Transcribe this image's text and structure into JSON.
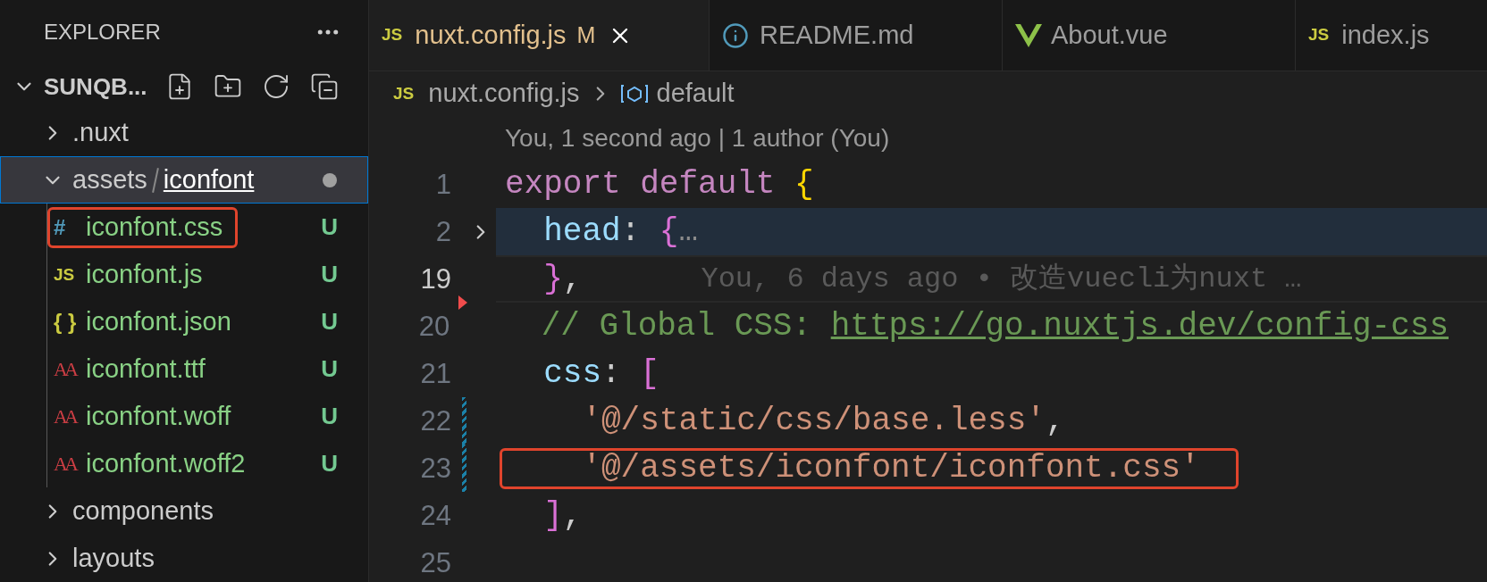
{
  "sidebar": {
    "title": "EXPLORER",
    "root": {
      "label": "SUNQB...",
      "expanded": true
    },
    "items": [
      {
        "label": ".nuxt",
        "expanded": false,
        "selected": false,
        "modified": false
      },
      {
        "label": "assets",
        "sublabel": "iconfont",
        "expanded": true,
        "selected": true,
        "modified": true,
        "children": [
          {
            "label": "iconfont.css",
            "kind": "css",
            "icon": "#",
            "status": "U",
            "highlighted": true
          },
          {
            "label": "iconfont.js",
            "kind": "js",
            "icon": "JS",
            "status": "U",
            "highlighted": false
          },
          {
            "label": "iconfont.json",
            "kind": "json",
            "icon": "{ }",
            "status": "U",
            "highlighted": false
          },
          {
            "label": "iconfont.ttf",
            "kind": "font",
            "icon": "AA",
            "status": "U",
            "highlighted": false
          },
          {
            "label": "iconfont.woff",
            "kind": "font",
            "icon": "AA",
            "status": "U",
            "highlighted": false
          },
          {
            "label": "iconfont.woff2",
            "kind": "font",
            "icon": "AA",
            "status": "U",
            "highlighted": false
          }
        ]
      },
      {
        "label": "components",
        "expanded": false,
        "selected": false,
        "modified": false
      },
      {
        "label": "layouts",
        "expanded": false,
        "selected": false,
        "modified": false
      }
    ]
  },
  "tabs": [
    {
      "label": "nuxt.config.js",
      "kind": "js",
      "icon": "JS",
      "selected": true,
      "badge": "M"
    },
    {
      "label": "README.md",
      "kind": "info",
      "selected": false
    },
    {
      "label": "About.vue",
      "kind": "vue",
      "selected": false
    },
    {
      "label": "index.js",
      "kind": "js",
      "icon": "JS",
      "selected": false
    }
  ],
  "breadcrumb": {
    "file_icon": "JS",
    "file": "nuxt.config.js",
    "symbol": "default"
  },
  "codelens": "You, 1 second ago | 1 author (You)",
  "lines": [
    {
      "number": "1",
      "kind": "plain",
      "folded": false,
      "highlighted": false,
      "current": false,
      "boxed": false,
      "tokens": [
        {
          "kind": "keyword",
          "text": "export default "
        },
        {
          "kind": "gold",
          "text": "{"
        }
      ]
    },
    {
      "number": "2",
      "kind": "plain",
      "folded": true,
      "highlighted": true,
      "current": false,
      "boxed": false,
      "tokens": [
        {
          "kind": "property",
          "text": "  head"
        },
        {
          "kind": "punct",
          "text": ": "
        },
        {
          "kind": "orchid",
          "text": "{"
        },
        {
          "kind": "fold",
          "text": "…"
        }
      ]
    },
    {
      "number": "19",
      "kind": "plain",
      "folded": false,
      "highlighted": false,
      "current": true,
      "boxed": false,
      "tokens": [
        {
          "kind": "orchid",
          "text": "  }"
        },
        {
          "kind": "punct",
          "text": ","
        }
      ],
      "blame": "You, 6 days ago • 改造vuecli为nuxt …"
    },
    {
      "number": "20",
      "kind": "deleted",
      "folded": false,
      "highlighted": false,
      "current": false,
      "boxed": false,
      "tokens": [
        {
          "kind": "comment",
          "text": "  // Global CSS: "
        },
        {
          "kind": "link",
          "text": "https://go.nuxtjs.dev/config-css"
        }
      ]
    },
    {
      "number": "21",
      "kind": "plain",
      "folded": false,
      "highlighted": false,
      "current": false,
      "boxed": false,
      "tokens": [
        {
          "kind": "property",
          "text": "  css"
        },
        {
          "kind": "punct",
          "text": ": "
        },
        {
          "kind": "orchid",
          "text": "["
        }
      ]
    },
    {
      "number": "22",
      "kind": "modified",
      "folded": false,
      "highlighted": false,
      "current": false,
      "boxed": false,
      "tokens": [
        {
          "kind": "string",
          "text": "    '@/static/css/base.less'"
        },
        {
          "kind": "punct",
          "text": ","
        }
      ]
    },
    {
      "number": "23",
      "kind": "modified",
      "folded": false,
      "highlighted": false,
      "current": false,
      "boxed": true,
      "tokens": [
        {
          "kind": "string",
          "text": "    '@/assets/iconfont/iconfont.css'"
        }
      ]
    },
    {
      "number": "24",
      "kind": "plain",
      "folded": false,
      "highlighted": false,
      "current": false,
      "boxed": false,
      "tokens": [
        {
          "kind": "orchid",
          "text": "  ]"
        },
        {
          "kind": "punct",
          "text": ","
        }
      ]
    },
    {
      "number": "25",
      "kind": "plain",
      "folded": false,
      "current": false
    }
  ]
}
